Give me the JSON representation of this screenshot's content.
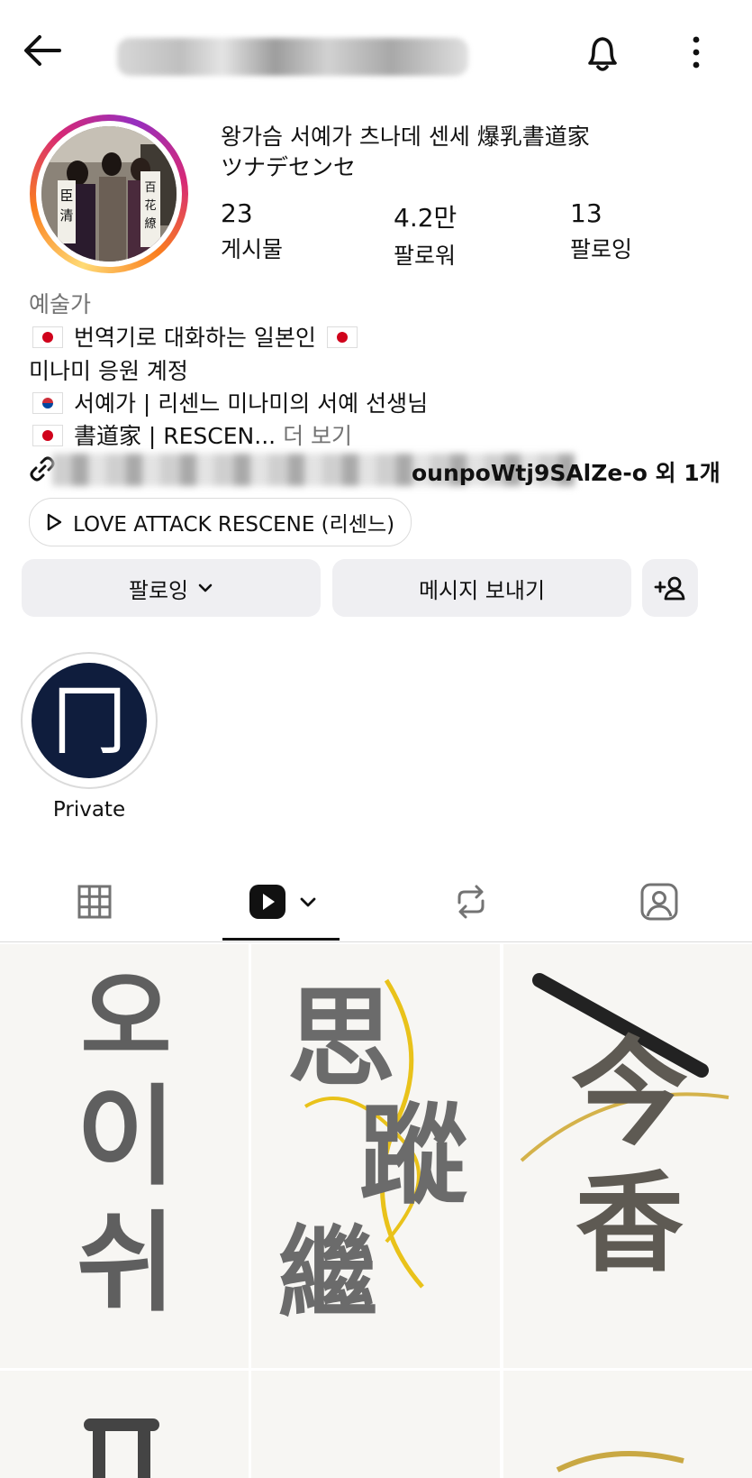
{
  "header": {
    "back_icon": "arrow-left-icon",
    "username": "",
    "notification_icon": "bell-icon",
    "more_icon": "more-vertical-icon"
  },
  "profile": {
    "name_line1": "왕가슴 서예가 츠나데 센세 爆乳書道家",
    "name_line2": "ツナデセンセ",
    "stats": [
      {
        "value": "23",
        "label": "게시물"
      },
      {
        "value": "4.2만",
        "label": "팔로워"
      },
      {
        "value": "13",
        "label": "팔로잉"
      }
    ],
    "category": "예술가",
    "bio": {
      "line1": "번역기로 대화하는 일본인",
      "line2": "미나미 응원 계정",
      "line3": "서예가 | 리센느 미나미의 서예 선생님",
      "line4": "書道家 | RESCEN...",
      "more": "더 보기"
    },
    "link_visible_text": "ounpoWtj9SAlZe-o 외 1개",
    "music": "LOVE ATTACK  RESCENE (리센느)"
  },
  "actions": {
    "following_label": "팔로잉",
    "message_label": "메시지 보내기",
    "add_person_icon": "add-person-icon"
  },
  "highlights": [
    {
      "label": "Private",
      "glyph": "冂"
    }
  ],
  "tabs": [
    {
      "name": "grid",
      "icon": "grid-icon",
      "active": false
    },
    {
      "name": "reels",
      "icon": "reels-icon",
      "active": true
    },
    {
      "name": "reposts",
      "icon": "repost-icon",
      "active": false
    },
    {
      "name": "tagged",
      "icon": "tagged-icon",
      "active": false
    }
  ],
  "posts": [
    {
      "chars": [
        "오",
        "이",
        "쉬"
      ]
    },
    {
      "chars": [
        "思",
        "蹤",
        "繼"
      ]
    },
    {
      "chars": [
        "今",
        "香"
      ]
    }
  ],
  "colors": {
    "accent_gold": "#e9c21a",
    "button_bg": "#efeff2",
    "muted_text": "#737373",
    "highlight_bg": "#0f1d3d"
  }
}
